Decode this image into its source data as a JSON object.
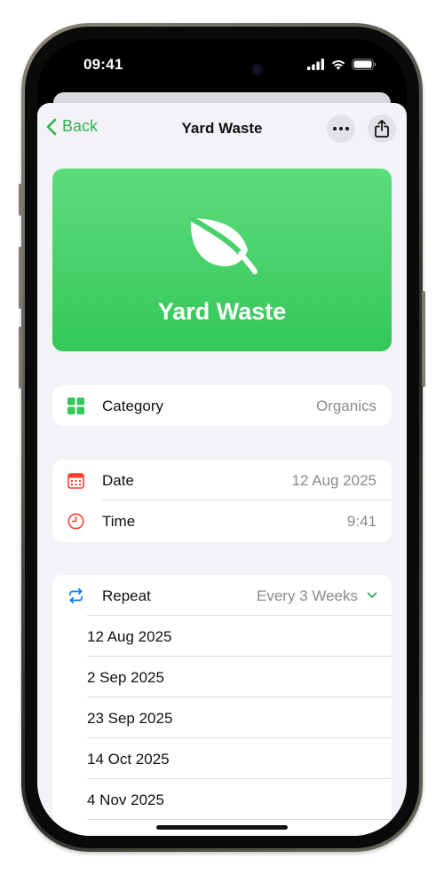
{
  "status_bar": {
    "time": "09:41"
  },
  "nav": {
    "back_label": "Back",
    "title": "Yard Waste"
  },
  "hero": {
    "name": "Yard Waste",
    "icon": "leaf-icon",
    "color": "#34c759"
  },
  "category": {
    "label": "Category",
    "value": "Organics"
  },
  "schedule": {
    "date_label": "Date",
    "date_value": "12 Aug 2025",
    "time_label": "Time",
    "time_value": "9:41"
  },
  "repeat": {
    "label": "Repeat",
    "value": "Every 3 Weeks",
    "dates": [
      "12 Aug 2025",
      "2 Sep 2025",
      "23 Sep 2025",
      "14 Oct 2025",
      "4 Nov 2025"
    ]
  },
  "colors": {
    "accent": "#30b350",
    "calendar": "#ff3b30",
    "repeat": "#007aff"
  }
}
